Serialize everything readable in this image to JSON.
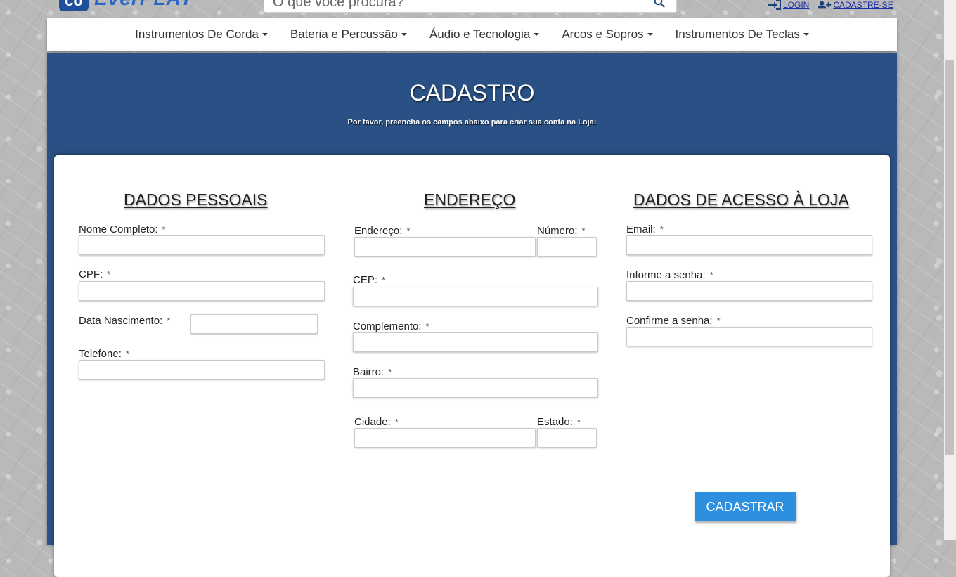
{
  "header": {
    "logo_mark": "co",
    "logo_text": "EverPLAY",
    "search_placeholder": "O que você procura?",
    "login_label": "LOGIN",
    "signup_label": "CADASTRE-SE"
  },
  "nav": {
    "items": [
      {
        "label": "Instrumentos De Corda"
      },
      {
        "label": "Bateria e Percussão"
      },
      {
        "label": "Áudio e Tecnologia"
      },
      {
        "label": "Arcos e Sopros"
      },
      {
        "label": "Instrumentos De Teclas"
      }
    ]
  },
  "page": {
    "title": "CADASTRO",
    "subtitle": "Por favor, preencha os campos abaixo para criar sua conta na Loja:"
  },
  "form": {
    "required_mark": "*",
    "pessoais": {
      "title": "DADOS PESSOAIS",
      "nome_label": "Nome Completo:",
      "cpf_label": "CPF:",
      "nascimento_label": "Data Nascimento:",
      "telefone_label": "Telefone:"
    },
    "endereco": {
      "title": "ENDEREÇO",
      "endereco_label": "Endereço:",
      "numero_label": "Número:",
      "cep_label": "CEP:",
      "complemento_label": "Complemento:",
      "bairro_label": "Bairro:",
      "cidade_label": "Cidade:",
      "estado_label": "Estado:"
    },
    "acesso": {
      "title": "DADOS DE ACESSO À LOJA",
      "email_label": "Email:",
      "senha_label": "Informe a senha:",
      "confirma_label": "Confirme a senha:"
    },
    "submit_label": "CADASTRAR"
  },
  "colors": {
    "brand_blue": "#2a5185",
    "button_blue": "#2d8fe0",
    "link_blue": "#1a2ea8"
  }
}
